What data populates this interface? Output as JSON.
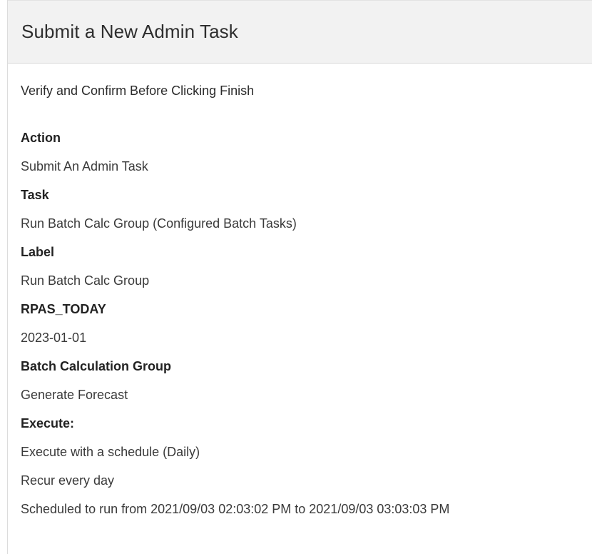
{
  "dialog": {
    "title": "Submit a New Admin Task",
    "intro": "Verify and Confirm Before Clicking Finish"
  },
  "summary": {
    "action_label": "Action",
    "action_value": "Submit An Admin Task",
    "task_label": "Task",
    "task_value": "Run Batch Calc Group (Configured Batch Tasks)",
    "label_label": "Label",
    "label_value": "Run Batch Calc Group",
    "rpas_today_label": "RPAS_TODAY",
    "rpas_today_value": "2023-01-01",
    "batch_group_label": "Batch Calculation Group",
    "batch_group_value": "Generate Forecast",
    "execute_label": "Execute:",
    "execute_mode": "Execute with a schedule (Daily)",
    "recurrence": "Recur every day",
    "schedule_range": "Scheduled to run from 2021/09/03 02:03:02 PM to 2021/09/03 03:03:03 PM"
  }
}
